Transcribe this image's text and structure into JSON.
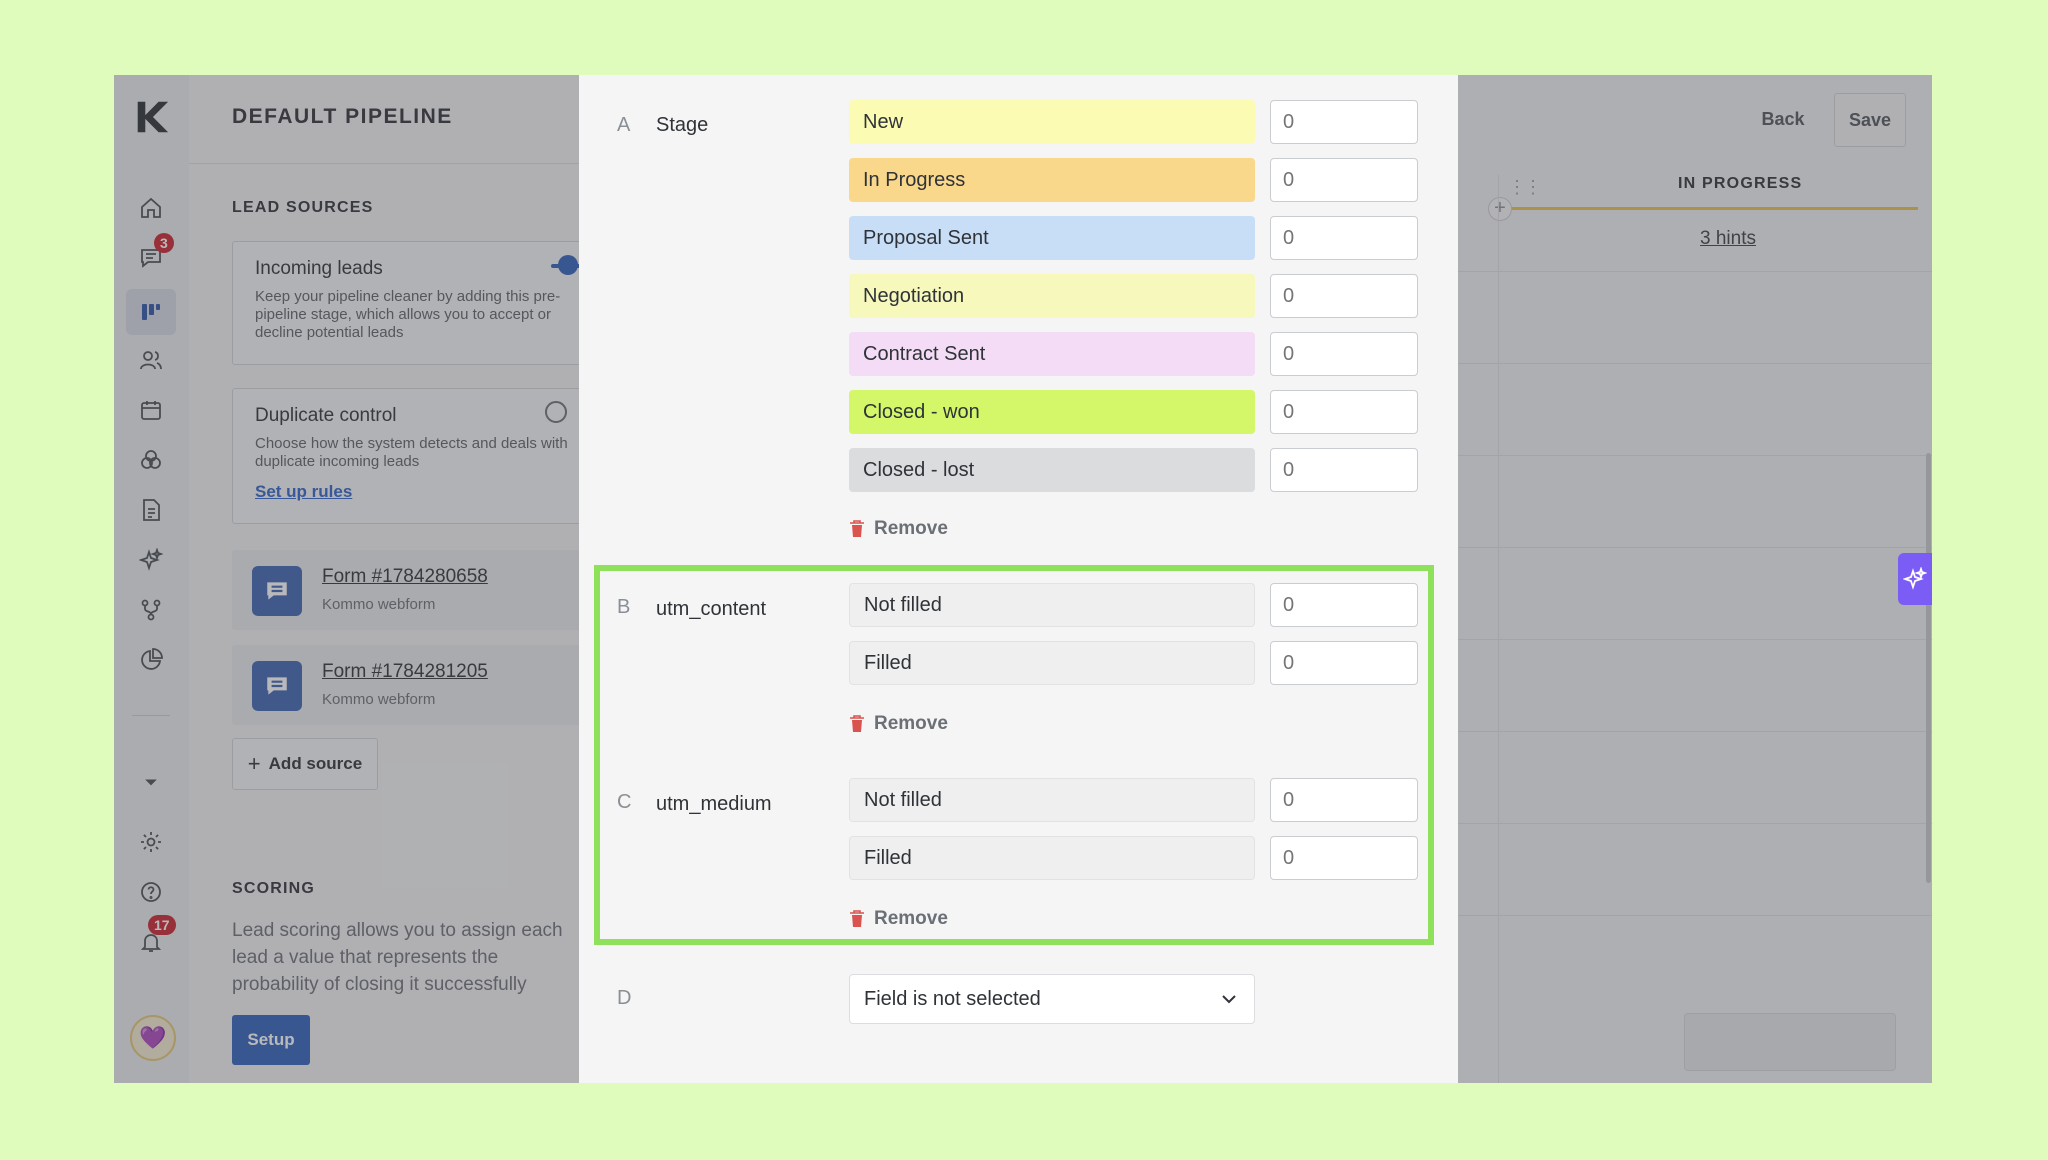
{
  "nav": {
    "items": [
      {
        "name": "home-icon"
      },
      {
        "name": "chat-icon",
        "badge": "3"
      },
      {
        "name": "pipeline-icon"
      },
      {
        "name": "contacts-icon"
      },
      {
        "name": "calendar-icon"
      },
      {
        "name": "integrations-icon"
      },
      {
        "name": "documents-icon"
      },
      {
        "name": "ai-sparkle-icon"
      },
      {
        "name": "automation-icon"
      },
      {
        "name": "reports-icon"
      },
      {
        "name": "settings-icon"
      },
      {
        "name": "help-icon"
      },
      {
        "name": "notifications-icon",
        "badge": "17"
      }
    ]
  },
  "left_panel": {
    "title": "DEFAULT PIPELINE",
    "lead_sources_heading": "LEAD SOURCES",
    "incoming": {
      "title": "Incoming leads",
      "description": "Keep your pipeline cleaner by adding this pre-pipeline stage, which allows you to accept or decline potential leads"
    },
    "duplicate": {
      "title": "Duplicate control",
      "description": "Choose how the system detects and deals with duplicate incoming leads",
      "link": "Set up rules"
    },
    "forms": [
      {
        "title": "Form #1784280658",
        "subtitle": "Kommo webform"
      },
      {
        "title": "Form #1784281205",
        "subtitle": "Kommo webform"
      }
    ],
    "add_source": "Add source",
    "scoring_heading": "SCORING",
    "scoring_description": "Lead scoring allows you to assign each lead a value that represents the probability of closing it successfully",
    "setup_button": "Setup"
  },
  "board": {
    "back_button": "Back",
    "save_button": "Save",
    "column_title": "IN PROGRESS",
    "hints_link": "3 hints"
  },
  "modal": {
    "rows": [
      {
        "letter": "A",
        "label": "Stage",
        "options": [
          {
            "label": "New",
            "value": "",
            "placeholder": "0",
            "color": "#fcfbb4"
          },
          {
            "label": "In Progress",
            "value": "",
            "placeholder": "0",
            "color": "#f9d88c"
          },
          {
            "label": "Proposal Sent",
            "value": "",
            "placeholder": "0",
            "color": "#c8def7"
          },
          {
            "label": "Negotiation",
            "value": "",
            "placeholder": "0",
            "color": "#f6f8bc"
          },
          {
            "label": "Contract Sent",
            "value": "",
            "placeholder": "0",
            "color": "#f4dcf6"
          },
          {
            "label": "Closed - won",
            "value": "",
            "placeholder": "0",
            "color": "#d4f76a"
          },
          {
            "label": "Closed - lost",
            "value": "",
            "placeholder": "0",
            "color": "#dbdcde"
          }
        ],
        "remove_label": "Remove"
      },
      {
        "letter": "B",
        "label": "utm_content",
        "options": [
          {
            "label": "Not filled",
            "value": "",
            "placeholder": "0"
          },
          {
            "label": "Filled",
            "value": "",
            "placeholder": "0"
          }
        ],
        "remove_label": "Remove"
      },
      {
        "letter": "C",
        "label": "utm_medium",
        "options": [
          {
            "label": "Not filled",
            "value": "",
            "placeholder": "0"
          },
          {
            "label": "Filled",
            "value": "",
            "placeholder": "0"
          }
        ],
        "remove_label": "Remove"
      }
    ],
    "row_d": {
      "letter": "D",
      "select_value": "Field is not selected"
    }
  },
  "colors": {
    "highlight": "#8fe05b",
    "accent": "#2f5fb8",
    "badge": "#c8232c",
    "ai_button": "#7b5cf5",
    "remove_icon": "#d9534f"
  }
}
